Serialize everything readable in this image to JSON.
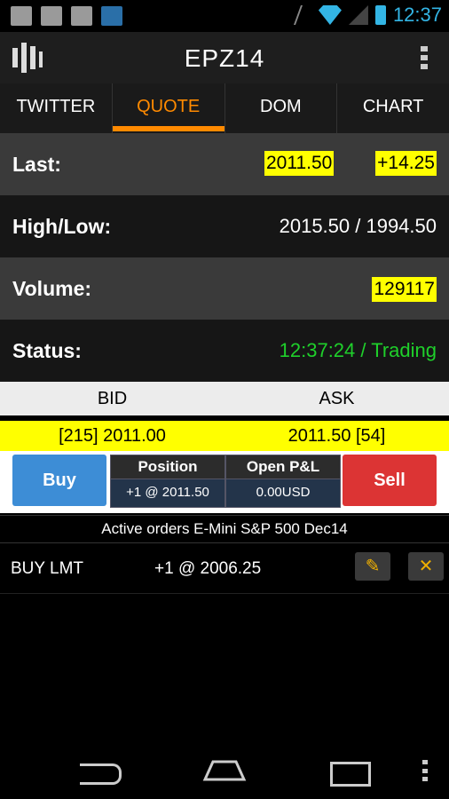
{
  "statusbar": {
    "time": "12:37"
  },
  "actionbar": {
    "title": "EPZ14"
  },
  "tabs": [
    {
      "label": "TWITTER"
    },
    {
      "label": "QUOTE"
    },
    {
      "label": "DOM"
    },
    {
      "label": "CHART"
    }
  ],
  "active_tab": "QUOTE",
  "quote": {
    "last_label": "Last:",
    "last_price": "2011.50",
    "last_change": "+14.25",
    "highlow_label": "High/Low:",
    "highlow_value": "2015.50 / 1994.50",
    "volume_label": "Volume:",
    "volume_value": "129117",
    "status_label": "Status:",
    "status_value": "12:37:24 / Trading"
  },
  "book": {
    "bid_header": "BID",
    "ask_header": "ASK",
    "bid": "[215] 2011.00",
    "ask": "2011.50 [54]"
  },
  "trade": {
    "buy_label": "Buy",
    "sell_label": "Sell",
    "position_header": "Position",
    "position_value": "+1 @ 2011.50",
    "pnl_header": "Open P&L",
    "pnl_value": "0.00USD"
  },
  "orders": {
    "header": "Active orders E-Mini S&P 500 Dec14",
    "items": [
      {
        "type": "BUY LMT",
        "qty_price": "+1 @ 2006.25"
      }
    ]
  },
  "colors": {
    "accent": "#ff8a00",
    "highlight": "#ffff00",
    "trading_status": "#1fd02b",
    "buy": "#3d8dd6",
    "sell": "#dc3434"
  },
  "icons": [
    "mail-icon",
    "cloud-upload-icon",
    "image-icon",
    "app-notification-icon",
    "mute-icon",
    "wifi-icon",
    "signal-icon",
    "battery-icon",
    "candlestick-chart-icon",
    "overflow-menu-icon",
    "edit-icon",
    "close-icon",
    "back-icon",
    "home-icon",
    "recent-apps-icon",
    "menu-icon"
  ]
}
